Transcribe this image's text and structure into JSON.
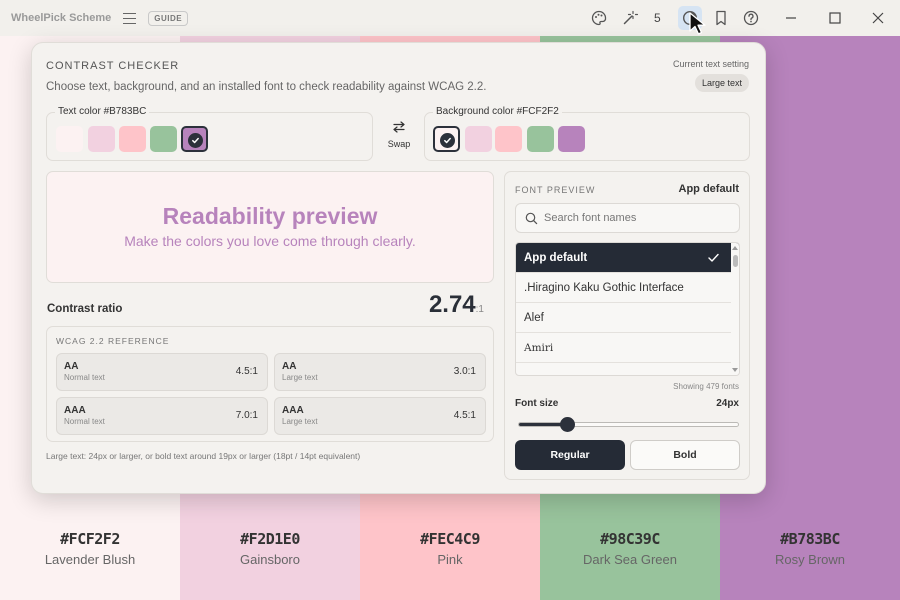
{
  "app": {
    "title": "WheelPick Scheme",
    "guide_badge": "GUIDE"
  },
  "toolbar": {
    "count": "5",
    "icons": [
      "palette-icon",
      "magic-wand-icon",
      "contrast-icon",
      "bookmark-icon",
      "help-icon"
    ],
    "window_controls": [
      "minimize-icon",
      "maximize-icon",
      "close-icon"
    ]
  },
  "palette": [
    {
      "hex": "#FCF2F2",
      "name": "Lavender Blush",
      "color": "#fcf2f2"
    },
    {
      "hex": "#F2D1E0",
      "name": "Gainsboro",
      "color": "#f2d1e0"
    },
    {
      "hex": "#FEC4C9",
      "name": "Pink",
      "color": "#fec4c9"
    },
    {
      "hex": "#98C39C",
      "name": "Dark Sea Green",
      "color": "#98c39c"
    },
    {
      "hex": "#B783BC",
      "name": "Rosy Brown",
      "color": "#b783bc"
    }
  ],
  "panel": {
    "title": "CONTRAST CHECKER",
    "description": "Choose text, background, and an installed font to check readability against WCAG 2.2.",
    "current_setting_label": "Current text setting",
    "current_setting_value": "Large text",
    "text_color_label": "Text color #B783BC",
    "background_color_label": "Background color #FCF2F2",
    "swap_label": "Swap",
    "preview": {
      "title": "Readability preview",
      "subtitle": "Make the colors you love come through clearly.",
      "text_color": "#b783bc",
      "background": "#fcf2f2"
    },
    "contrast_label": "Contrast ratio",
    "contrast_value": "2.74",
    "contrast_suffix": ":1",
    "wcag": {
      "title": "WCAG 2.2 REFERENCE",
      "cards": [
        {
          "level": "AA",
          "type": "Normal text",
          "ratio": "4.5:1"
        },
        {
          "level": "AA",
          "type": "Large text",
          "ratio": "3.0:1"
        },
        {
          "level": "AAA",
          "type": "Normal text",
          "ratio": "7.0:1"
        },
        {
          "level": "AAA",
          "type": "Large text",
          "ratio": "4.5:1"
        }
      ]
    },
    "footnote": "Large text: 24px or larger, or bold text around 19px or larger (18pt / 14pt equivalent)"
  },
  "font_preview": {
    "label": "FONT PREVIEW",
    "current": "App default",
    "search_placeholder": "Search font names",
    "fonts": [
      "App default",
      ".Hiragino Kaku Gothic Interface",
      "Alef",
      "Amiri"
    ],
    "selected_index": 0,
    "showing": "Showing 479 fonts",
    "size_label": "Font size",
    "size_value": "24px",
    "size_fraction": 0.22,
    "weight_regular": "Regular",
    "weight_bold": "Bold",
    "active_weight": "Regular"
  }
}
